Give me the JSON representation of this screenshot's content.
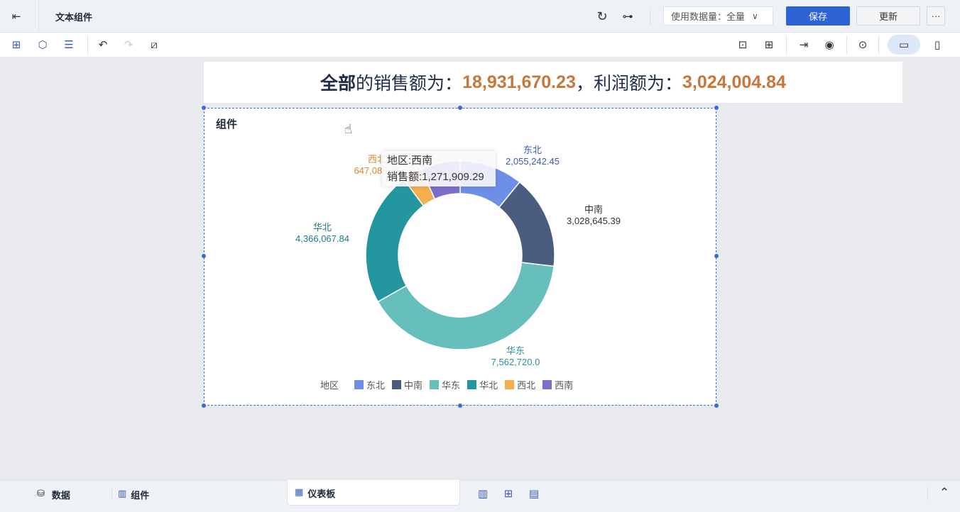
{
  "header": {
    "title": "文本组件",
    "data_amount_label": "使用数据量：全量",
    "save": "保存",
    "update": "更新",
    "more": "···"
  },
  "banner": {
    "scope": "全部",
    "text1": " 的销售额为：",
    "sales": "18,931,670.23",
    "text2": "，利润额为：",
    "profit": "3,024,004.84"
  },
  "widget": {
    "title": "组件"
  },
  "chart_data": {
    "type": "pie",
    "donut": true,
    "legend_title": "地区",
    "legend_position": "bottom",
    "categories": [
      "东北",
      "中南",
      "华东",
      "华北",
      "西北",
      "西南"
    ],
    "values": [
      2055242.45,
      3028645.39,
      7562720.0,
      4366067.84,
      647085.26,
      1271909.29
    ],
    "value_labels": [
      "2,055,242.45",
      "3,028,645.39",
      "7,562,720.0",
      "4,366,067.84",
      "647,085.26",
      "1,271,909.29"
    ],
    "colors": [
      "#6d8fe8",
      "#4a5d80",
      "#66bfba",
      "#2496a0",
      "#f5ae4f",
      "#7a6fc9"
    ]
  },
  "tooltip": {
    "line1": "地区:西南",
    "line2": "销售额:1,271,909.29"
  },
  "bottom": {
    "data": "数据",
    "component": "组件",
    "dashboard": "仪表板"
  }
}
